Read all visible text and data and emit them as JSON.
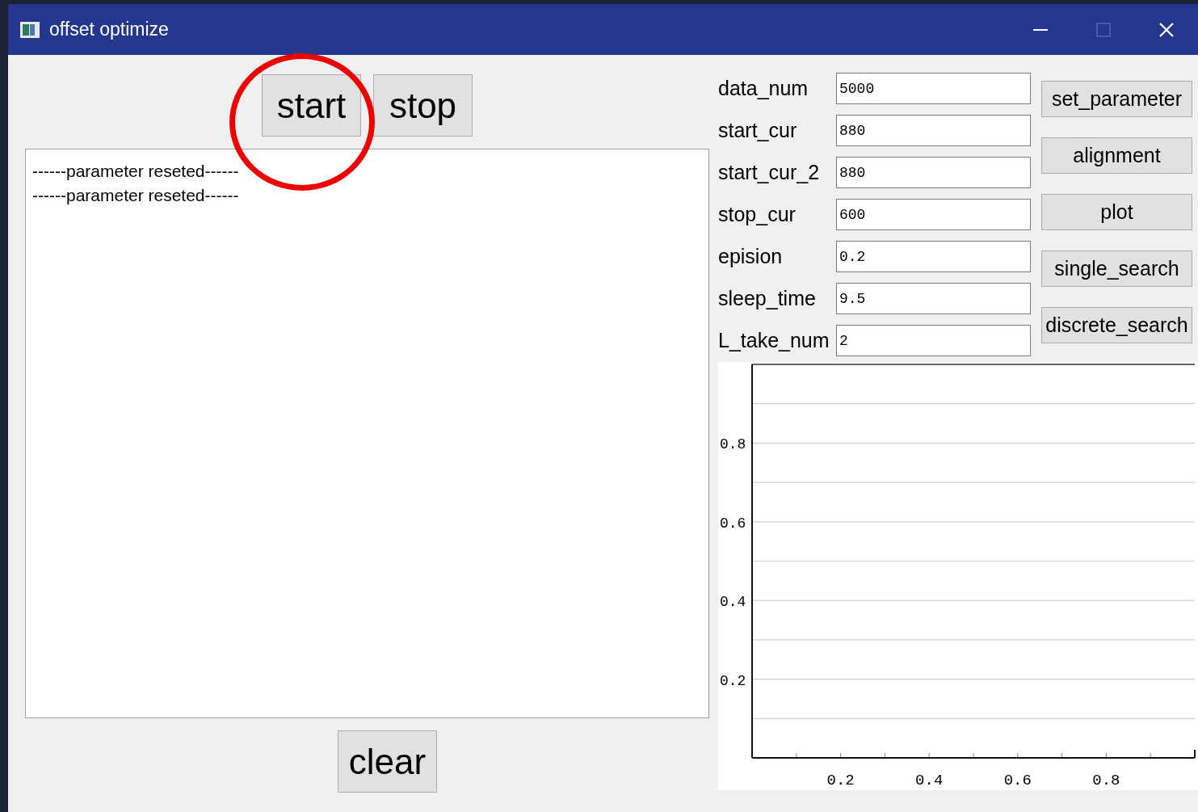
{
  "window": {
    "title": "offset optimize"
  },
  "run_buttons": [
    {
      "label": "start",
      "circled": true
    },
    {
      "label": "stop",
      "circled": false
    }
  ],
  "log": {
    "lines": [
      "------parameter reseted------",
      "------parameter reseted------"
    ]
  },
  "clear_button": {
    "label": "clear"
  },
  "parameters": [
    {
      "label": "data_num",
      "value": "5000"
    },
    {
      "label": "start_cur",
      "value": "880"
    },
    {
      "label": "start_cur_2",
      "value": "880"
    },
    {
      "label": "stop_cur",
      "value": "600"
    },
    {
      "label": "epision",
      "value": "0.2"
    },
    {
      "label": "sleep_time",
      "value": "9.5"
    },
    {
      "label": "L_take_num",
      "value": "2"
    }
  ],
  "actions": [
    "set_parameter",
    "alignment",
    "plot",
    "single_search",
    "discrete_search"
  ],
  "plot": {
    "chart_data": {
      "type": "line",
      "xlim": [
        0,
        1
      ],
      "ylim": [
        0,
        1
      ],
      "grid": true,
      "xticks": [
        0.2,
        0.4,
        0.6,
        0.8
      ],
      "yticks": [
        0.2,
        0.4,
        0.6,
        0.8
      ]
    }
  }
}
